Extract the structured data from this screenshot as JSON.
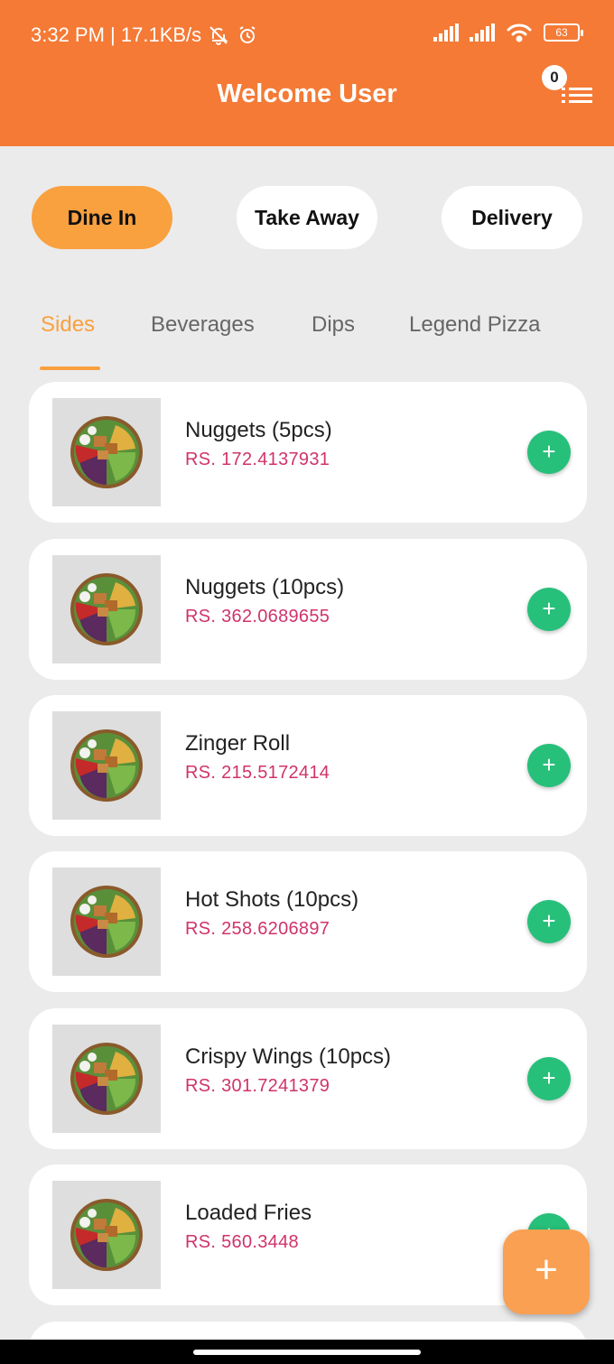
{
  "status_bar": {
    "left_text": "3:32 PM | 17.1KB/s",
    "battery": "63"
  },
  "header": {
    "title": "Welcome User",
    "cart_count": "0"
  },
  "order_types": [
    {
      "label": "Dine In",
      "active": true
    },
    {
      "label": "Take Away",
      "active": false
    },
    {
      "label": "Delivery",
      "active": false
    }
  ],
  "category_tabs": [
    {
      "label": "Sides",
      "active": true
    },
    {
      "label": "Beverages",
      "active": false
    },
    {
      "label": "Dips",
      "active": false
    },
    {
      "label": "Legend Pizza",
      "active": false
    }
  ],
  "items": [
    {
      "name": "Nuggets (5pcs)",
      "price": "RS. 172.4137931",
      "add_icon": "+"
    },
    {
      "name": "Nuggets (10pcs)",
      "price": "RS. 362.0689655",
      "add_icon": "+"
    },
    {
      "name": "Zinger Roll",
      "price": "RS. 215.5172414",
      "add_icon": "+"
    },
    {
      "name": "Hot Shots (10pcs)",
      "price": "RS. 258.6206897",
      "add_icon": "+"
    },
    {
      "name": "Crispy Wings (10pcs)",
      "price": "RS. 301.7241379",
      "add_icon": "+"
    },
    {
      "name": "Loaded Fries",
      "price": "RS. 560.3448",
      "add_icon": "+"
    }
  ],
  "fab": {
    "icon": "+"
  },
  "colors": {
    "header": "#f47a36",
    "accent": "#f9a03f",
    "price": "#d0336b",
    "add": "#27c07a"
  }
}
